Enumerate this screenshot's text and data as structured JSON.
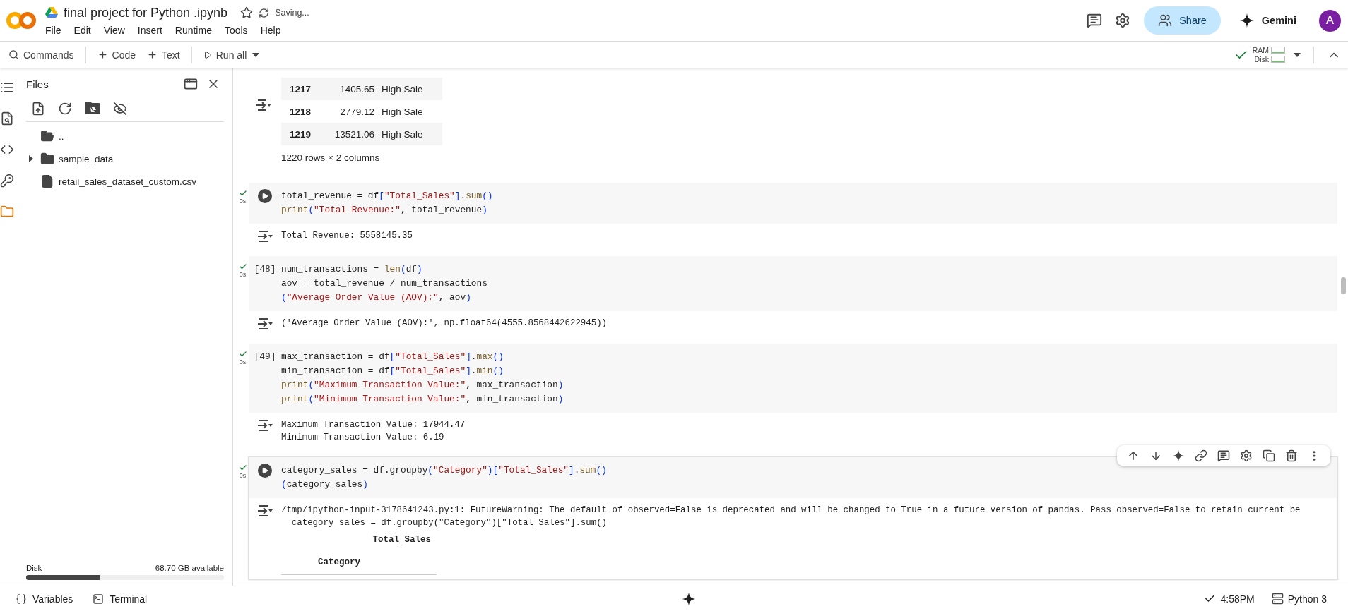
{
  "header": {
    "title": "final project for Python .ipynb",
    "status": "Saving...",
    "menu": [
      "File",
      "Edit",
      "View",
      "Insert",
      "Runtime",
      "Tools",
      "Help"
    ],
    "share": "Share",
    "gemini": "Gemini",
    "avatar": "A"
  },
  "toolbar": {
    "commands": "Commands",
    "add_code": "Code",
    "add_text": "Text",
    "run_all": "Run all",
    "connected": true,
    "ram": "RAM",
    "disk": "Disk"
  },
  "rail": [
    {
      "kind": "toc",
      "selected": false
    },
    {
      "kind": "find",
      "selected": false
    },
    {
      "kind": "snippets",
      "selected": false
    },
    {
      "kind": "secrets",
      "selected": false
    },
    {
      "kind": "files",
      "selected": true
    }
  ],
  "files_panel": {
    "title": "Files",
    "tree": [
      {
        "kind": "parent",
        "name": ".."
      },
      {
        "kind": "folder",
        "name": "sample_data",
        "expanded": false
      },
      {
        "kind": "file",
        "name": "retail_sales_dataset_custom.csv"
      }
    ],
    "disk": {
      "label": "Disk",
      "available": "68.70 GB available",
      "level": 0.37
    }
  },
  "notebook": {
    "partial_output": {
      "rows": [
        {
          "index": "1217",
          "value": "1405.65",
          "label": "High Sale"
        },
        {
          "index": "1218",
          "value": "2779.12",
          "label": "High Sale"
        },
        {
          "index": "1219",
          "value": "13521.06",
          "label": "High Sale"
        }
      ],
      "shape": "1220 rows × 2 columns"
    },
    "cells": [
      {
        "ran": true,
        "duration": "0s",
        "focused": false,
        "code": [
          [
            {
              "kind": "plain",
              "text": "total_revenue = df"
            },
            {
              "kind": "bracket",
              "text": "["
            },
            {
              "kind": "string",
              "text": "\"Total_Sales\""
            },
            {
              "kind": "bracket",
              "text": "]"
            },
            {
              "kind": "plain",
              "text": "."
            },
            {
              "kind": "func",
              "text": "sum"
            },
            {
              "kind": "bracket",
              "text": "()"
            }
          ],
          [
            {
              "kind": "func",
              "text": "print"
            },
            {
              "kind": "bracket",
              "text": "("
            },
            {
              "kind": "string",
              "text": "\"Total Revenue:\""
            },
            {
              "kind": "plain",
              "text": ", total_revenue"
            },
            {
              "kind": "bracket",
              "text": ")"
            }
          ]
        ],
        "output": {
          "lines": [
            "Total Revenue: 5558145.35"
          ]
        }
      },
      {
        "ran": true,
        "duration": "0s",
        "execution_count": "[48]",
        "focused": false,
        "code": [
          [
            {
              "kind": "plain",
              "text": "num_transactions = "
            },
            {
              "kind": "func",
              "text": "len"
            },
            {
              "kind": "bracket",
              "text": "("
            },
            {
              "kind": "plain",
              "text": "df"
            },
            {
              "kind": "bracket",
              "text": ")"
            }
          ],
          [
            {
              "kind": "plain",
              "text": "aov = total_revenue / num_transactions"
            }
          ],
          [
            {
              "kind": "bracket",
              "text": "("
            },
            {
              "kind": "string",
              "text": "\"Average Order Value (AOV):\""
            },
            {
              "kind": "plain",
              "text": ", aov"
            },
            {
              "kind": "bracket",
              "text": ")"
            }
          ]
        ],
        "output": {
          "lines": [
            "('Average Order Value (AOV):', np.float64(4555.8568442622945))"
          ]
        }
      },
      {
        "ran": true,
        "duration": "0s",
        "execution_count": "[49]",
        "focused": false,
        "code": [
          [
            {
              "kind": "plain",
              "text": "max_transaction = df"
            },
            {
              "kind": "bracket",
              "text": "["
            },
            {
              "kind": "string",
              "text": "\"Total_Sales\""
            },
            {
              "kind": "bracket",
              "text": "]"
            },
            {
              "kind": "plain",
              "text": "."
            },
            {
              "kind": "func",
              "text": "max"
            },
            {
              "kind": "bracket",
              "text": "()"
            }
          ],
          [
            {
              "kind": "plain",
              "text": "min_transaction = df"
            },
            {
              "kind": "bracket",
              "text": "["
            },
            {
              "kind": "string",
              "text": "\"Total_Sales\""
            },
            {
              "kind": "bracket",
              "text": "]"
            },
            {
              "kind": "plain",
              "text": "."
            },
            {
              "kind": "func",
              "text": "min"
            },
            {
              "kind": "bracket",
              "text": "()"
            }
          ],
          [
            {
              "kind": "func",
              "text": "print"
            },
            {
              "kind": "bracket",
              "text": "("
            },
            {
              "kind": "string",
              "text": "\"Maximum Transaction Value:\""
            },
            {
              "kind": "plain",
              "text": ", max_transaction"
            },
            {
              "kind": "bracket",
              "text": ")"
            }
          ],
          [
            {
              "kind": "func",
              "text": "print"
            },
            {
              "kind": "bracket",
              "text": "("
            },
            {
              "kind": "string",
              "text": "\"Minimum Transaction Value:\""
            },
            {
              "kind": "plain",
              "text": ", min_transaction"
            },
            {
              "kind": "bracket",
              "text": ")"
            }
          ]
        ],
        "output": {
          "lines": [
            "Maximum Transaction Value: 17944.47",
            "Minimum Transaction Value: 6.19"
          ]
        }
      },
      {
        "ran": true,
        "duration": "0s",
        "focused": true,
        "code": [
          [
            {
              "kind": "plain",
              "text": "category_sales = df.groupby"
            },
            {
              "kind": "bracket",
              "text": "("
            },
            {
              "kind": "string",
              "text": "\"Category\""
            },
            {
              "kind": "bracket",
              "text": ")["
            },
            {
              "kind": "string",
              "text": "\"Total_Sales\""
            },
            {
              "kind": "bracket",
              "text": "]"
            },
            {
              "kind": "plain",
              "text": "."
            },
            {
              "kind": "func",
              "text": "sum"
            },
            {
              "kind": "bracket",
              "text": "()"
            }
          ],
          [
            {
              "kind": "bracket",
              "text": "("
            },
            {
              "kind": "plain",
              "text": "category_sales"
            },
            {
              "kind": "bracket",
              "text": ")"
            }
          ]
        ],
        "output": {
          "lines": [
            "/tmp/ipython-input-3178641243.py:1: FutureWarning: The default of observed=False is deprecated and will be changed to True in a future version of pandas. Pass observed=False to retain current be",
            "  category_sales = df.groupby(\"Category\")[\"Total_Sales\"].sum()"
          ],
          "frame": {
            "column": "Total_Sales",
            "index_name": "Category"
          }
        }
      }
    ]
  },
  "status_bar": {
    "variables": "Variables",
    "terminal": "Terminal",
    "saved": true,
    "time": "4:58PM",
    "runtime": "Python 3"
  }
}
